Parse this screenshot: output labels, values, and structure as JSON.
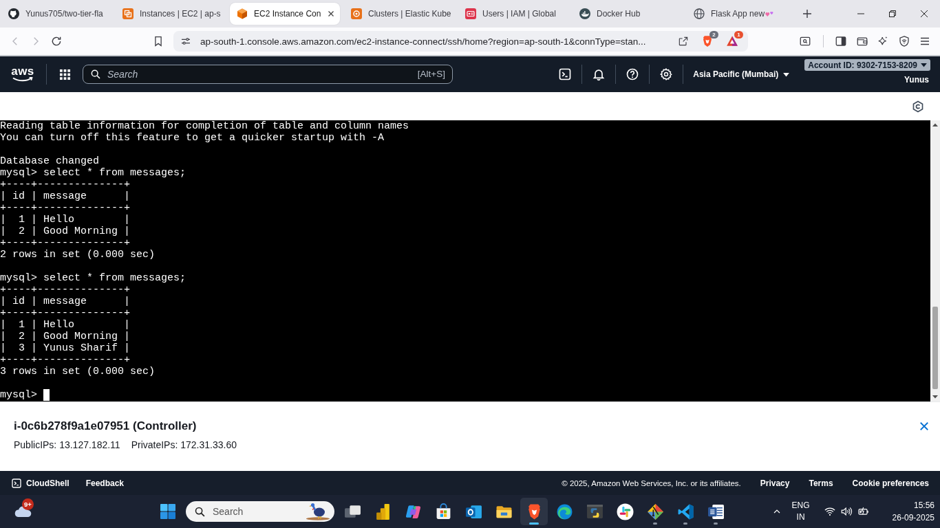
{
  "browser": {
    "tabs": [
      {
        "title": "Yunus705/two-tier-fla",
        "selected": false
      },
      {
        "title": "Instances | EC2 | ap-s",
        "selected": false
      },
      {
        "title": "EC2 Instance Con",
        "selected": true
      },
      {
        "title": "Clusters | Elastic Kube",
        "selected": false
      },
      {
        "title": "Users | IAM | Global",
        "selected": false
      },
      {
        "title": "Docker Hub",
        "selected": false
      },
      {
        "title": "Flask App new",
        "selected": false
      }
    ],
    "nav_buttons": [
      {
        "disabled": true
      },
      {
        "disabled": true
      },
      {
        "disabled": false
      }
    ],
    "url": "ap-south-1.console.aws.amazon.com/ec2-instance-connect/ssh/home?region=ap-south-1&connType=stan...",
    "shields_count": "2",
    "rewards_count": "1"
  },
  "console": {
    "logo": "aws",
    "search_placeholder": "Search",
    "search_shortcut": "[Alt+S]",
    "region": "Asia Pacific (Mumbai)",
    "account": "Account ID: 9302-7153-8209",
    "user": "Yunus"
  },
  "terminal": {
    "paragraphs": [
      [
        "Reading table information for completion of table and column names",
        "You can turn off this feature to get a quicker startup with -A"
      ],
      [
        "Database changed",
        "mysql> select * from messages;",
        "+----+--------------+",
        "| id | message      |",
        "+----+--------------+",
        "|  1 | Hello        |",
        "|  2 | Good Morning |",
        "+----+--------------+",
        "2 rows in set (0.000 sec)"
      ],
      [
        "mysql> select * from messages;",
        "+----+--------------+",
        "| id | message      |",
        "+----+--------------+",
        "|  1 | Hello        |",
        "|  2 | Good Morning |",
        "|  3 | Yunus Sharif |",
        "+----+--------------+",
        "3 rows in set (0.000 sec)"
      ]
    ],
    "prompt": "mysql>"
  },
  "instance_panel": {
    "title": "i-0c6b278f9a1e07951 (Controller)",
    "details": [
      "PublicIPs: 13.127.182.11",
      "PrivateIPs: 172.31.33.60"
    ]
  },
  "footer": {
    "cloudshell": "CloudShell",
    "feedback": "Feedback",
    "copyright": "© 2025, Amazon Web Services, Inc. or its affiliates.",
    "links": [
      "Privacy",
      "Terms",
      "Cookie preferences"
    ]
  },
  "taskbar": {
    "weather_badge": "9+",
    "search_placeholder": "Search",
    "apps": [
      {
        "running": false,
        "selected": false
      },
      {
        "running": false,
        "selected": false
      },
      {
        "running": false,
        "selected": false
      },
      {
        "running": false,
        "selected": false
      },
      {
        "running": false,
        "selected": false
      },
      {
        "running": false,
        "selected": false
      },
      {
        "running": true,
        "selected": true
      },
      {
        "running": false,
        "selected": false
      },
      {
        "running": false,
        "selected": false
      },
      {
        "running": false,
        "selected": false
      },
      {
        "running": true,
        "selected": false
      },
      {
        "running": true,
        "selected": false
      },
      {
        "running": true,
        "selected": false
      }
    ],
    "language": "ENG",
    "region": "IN",
    "time": "15:56",
    "date": "26-09-2025"
  }
}
